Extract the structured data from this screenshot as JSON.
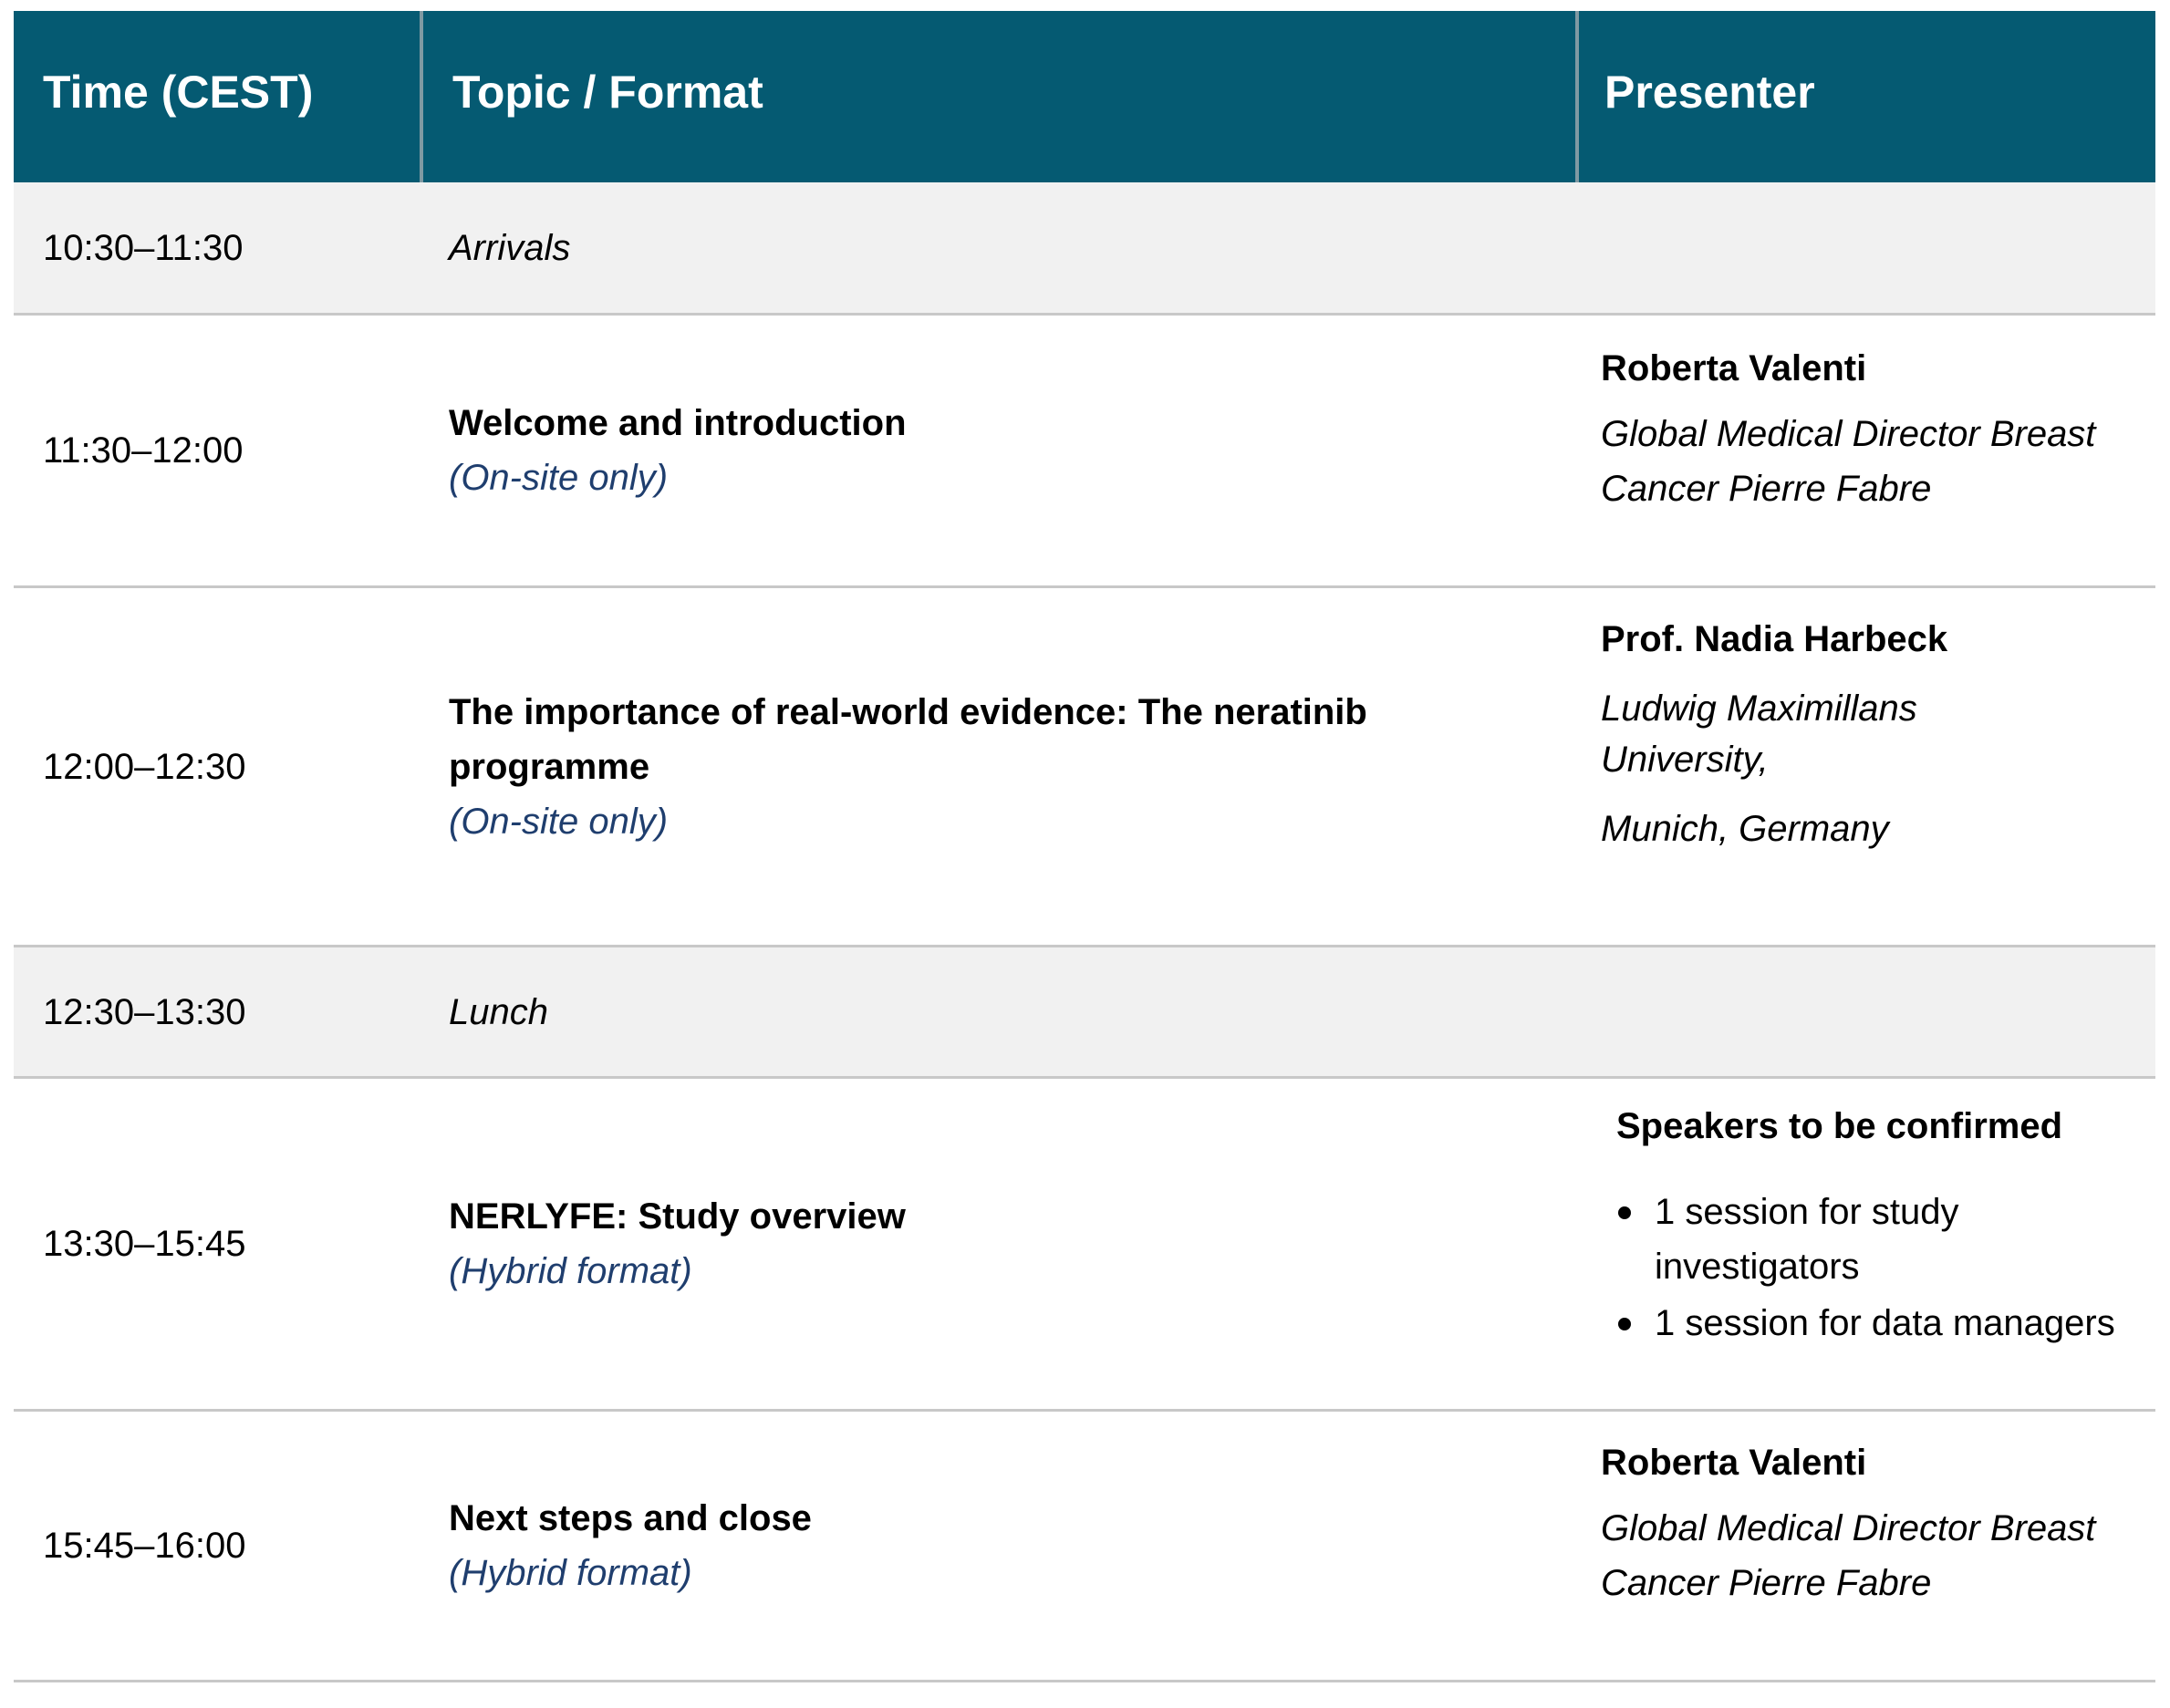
{
  "header": {
    "time": "Time (CEST)",
    "topic": "Topic / Format",
    "presenter": "Presenter"
  },
  "rows": [
    {
      "time": "10:30–11:30",
      "topic": "Arrivals"
    },
    {
      "time": "11:30–12:00",
      "topic": "Welcome and introduction",
      "format": "(On-site only)",
      "presenter_name": "Roberta Valenti",
      "presenter_affil_1": "Global Medical Director Breast",
      "presenter_affil_2": "Cancer Pierre Fabre"
    },
    {
      "time": "12:00–12:30",
      "topic_line_1": "The importance of real-world evidence: The neratinib",
      "topic_line_2": "programme",
      "format": "(On-site only)",
      "presenter_name": "Prof. Nadia Harbeck",
      "presenter_affil_1": "Ludwig Maximillans",
      "presenter_affil_2": "University,",
      "presenter_affil_3": "Munich, Germany"
    },
    {
      "time": "12:30–13:30",
      "topic": "Lunch"
    },
    {
      "time": "13:30–15:45",
      "topic": "NERLYFE: Study overview",
      "format": "(Hybrid format)",
      "presenter_name": "Speakers to be confirmed",
      "session_1_line_1": "1 session for study",
      "session_1_line_2": "investigators",
      "session_2": "1 session for data managers"
    },
    {
      "time": "15:45–16:00",
      "topic": "Next steps and close",
      "format": "(Hybrid format)",
      "presenter_name": "Roberta Valenti",
      "presenter_affil_1": "Global Medical Director Breast",
      "presenter_affil_2": "Cancer Pierre Fabre"
    }
  ]
}
